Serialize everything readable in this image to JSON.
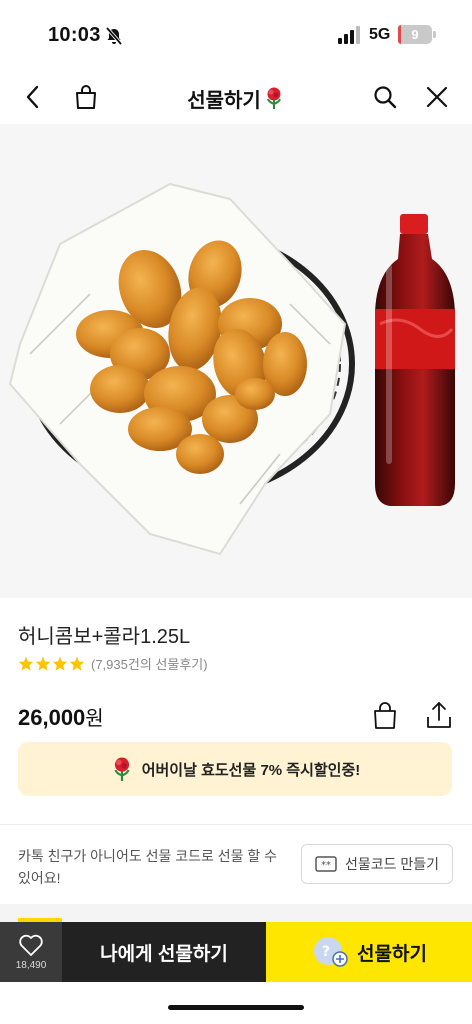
{
  "status_bar": {
    "time": "10:03",
    "network": "5G",
    "battery": "9",
    "battery_level": 0.09,
    "icons": [
      "bell-slash-icon",
      "signal-icon",
      "battery-icon"
    ]
  },
  "navbar": {
    "title": "선물하기",
    "icons": [
      "back-chevron-icon",
      "shopping-bag-icon",
      "flower-icon",
      "search-icon",
      "close-icon"
    ]
  },
  "product": {
    "image": "fried-chicken-and-cola-photo",
    "name": "허니콤보+콜라1.25L",
    "stars": 4,
    "review_text": "(7,935건의 선물후기)",
    "price_amount": "26,000",
    "price_unit": "원",
    "action_icons": [
      "gift-bag-icon",
      "share-icon"
    ]
  },
  "promo": {
    "text": "어버이날 효도선물 7% 즉시할인중!"
  },
  "gift_code": {
    "message": "카톡 친구가 아니어도 선물 코드로 선물 할 수 있어요!",
    "button_label": "선물코드 만들기"
  },
  "bottom_bar": {
    "like_count": "18,490",
    "self_gift_label": "나에게 선물하기",
    "gift_label": "선물하기"
  },
  "colors": {
    "accent_yellow": "#ffe600",
    "promo_bg": "#fff3d4",
    "star": "#ffc400",
    "dark": "#222222"
  }
}
